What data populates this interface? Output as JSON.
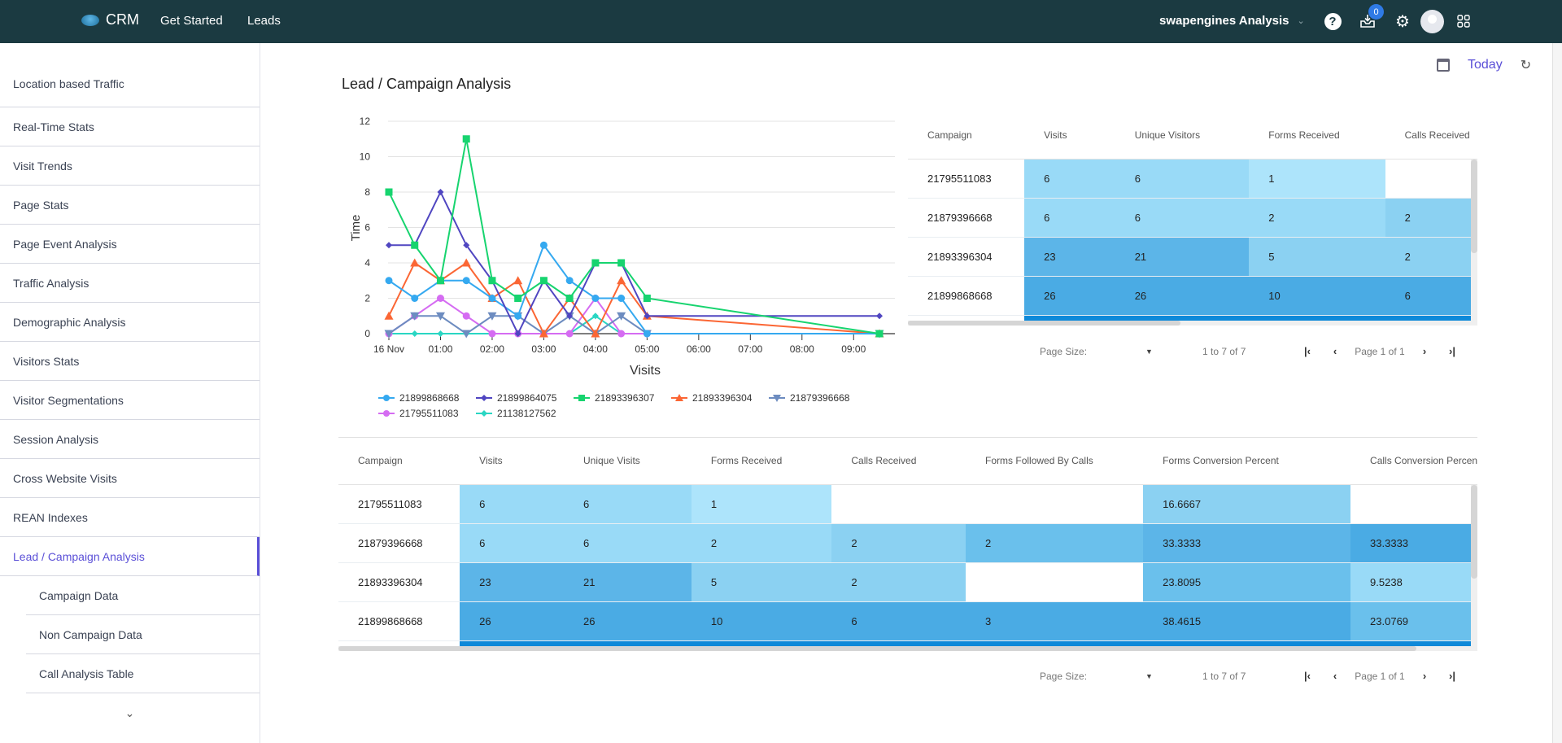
{
  "topbar": {
    "brand": "CRM",
    "nav": [
      "Get Started",
      "Leads"
    ],
    "workspace": "swapengines Analysis",
    "notification_count": "0",
    "icons": [
      "help-icon",
      "inbox-download-icon",
      "gear-icon",
      "avatar",
      "apps-grid-icon"
    ]
  },
  "sidebar": {
    "items": [
      {
        "label": "Location based Traffic"
      },
      {
        "label": "Real-Time Stats"
      },
      {
        "label": "Visit Trends"
      },
      {
        "label": "Page Stats"
      },
      {
        "label": "Page Event Analysis"
      },
      {
        "label": "Traffic Analysis"
      },
      {
        "label": "Demographic Analysis"
      },
      {
        "label": "Visitors Stats"
      },
      {
        "label": "Visitor Segmentations"
      },
      {
        "label": "Session Analysis"
      },
      {
        "label": "Cross Website Visits"
      },
      {
        "label": "REAN Indexes"
      },
      {
        "label": "Lead / Campaign Analysis",
        "active": true
      }
    ],
    "subitems": [
      {
        "label": "Campaign Data"
      },
      {
        "label": "Non Campaign Data"
      },
      {
        "label": "Call Analysis Table"
      }
    ],
    "more_icon": "chevron-down-icon"
  },
  "main": {
    "title": "Lead / Campaign Analysis",
    "date_label": "Today",
    "accent": "#5a4fd7"
  },
  "chart_data": {
    "type": "line",
    "title": "",
    "xlabel": "Visits",
    "ylabel": "Time",
    "ylim": [
      0,
      12
    ],
    "yticks": [
      0,
      2,
      4,
      6,
      8,
      10,
      12
    ],
    "grid": true,
    "legend_position": "bottom",
    "x_tick_labels": [
      "16 Nov",
      "01:00",
      "02:00",
      "03:00",
      "04:00",
      "05:00",
      "06:00",
      "07:00",
      "08:00",
      "09:00"
    ],
    "x_range_hours": [
      0,
      9.5
    ],
    "x_hours": [
      0,
      0.5,
      1,
      1.5,
      2,
      2.5,
      3,
      3.5,
      4,
      4.5,
      5,
      9.5
    ],
    "series": [
      {
        "name": "21899868668",
        "color": "#35a9f0",
        "marker": "circle",
        "values": [
          3,
          2,
          3,
          3,
          2,
          1,
          5,
          3,
          2,
          2,
          0,
          0
        ]
      },
      {
        "name": "21899864075",
        "color": "#5046c1",
        "marker": "diamond",
        "values": [
          5,
          5,
          8,
          5,
          3,
          0,
          3,
          1,
          4,
          4,
          1,
          1
        ]
      },
      {
        "name": "21893396307",
        "color": "#17d46f",
        "marker": "square",
        "values": [
          8,
          5,
          3,
          11,
          3,
          2,
          3,
          2,
          4,
          4,
          2,
          0
        ]
      },
      {
        "name": "21893396304",
        "color": "#fb6634",
        "marker": "triangle",
        "values": [
          1,
          4,
          3,
          4,
          2,
          3,
          0,
          2,
          0,
          3,
          1,
          0
        ]
      },
      {
        "name": "21879396668",
        "color": "#6d8cc0",
        "marker": "triangle-down",
        "values": [
          0,
          1,
          1,
          0,
          1,
          1,
          0,
          1,
          0,
          1,
          0,
          0
        ]
      },
      {
        "name": "21795511083",
        "color": "#d56cf2",
        "marker": "circle",
        "values": [
          0,
          1,
          2,
          1,
          0,
          0,
          0,
          0,
          2,
          0,
          0,
          0
        ]
      },
      {
        "name": "21138127562",
        "color": "#2ad6c3",
        "marker": "diamond",
        "values": [
          0,
          0,
          0,
          0,
          0,
          0,
          0,
          0,
          1,
          0,
          0,
          0
        ]
      }
    ]
  },
  "table_top": {
    "columns": [
      "Campaign",
      "Visits",
      "Unique Visitors",
      "Forms Received",
      "Calls Received"
    ],
    "rows": [
      [
        "21795511083",
        "6",
        "6",
        "1",
        ""
      ],
      [
        "21879396668",
        "6",
        "6",
        "2",
        "2"
      ],
      [
        "21893396304",
        "23",
        "21",
        "5",
        "2"
      ],
      [
        "21899868668",
        "26",
        "26",
        "10",
        "6"
      ]
    ],
    "pager": {
      "page_size_label": "Page Size:",
      "count": "1 to 7 of 7",
      "page_info": "Page 1 of 1"
    }
  },
  "table_bottom": {
    "columns": [
      "Campaign",
      "Visits",
      "Unique Visits",
      "Forms Received",
      "Calls Received",
      "Forms Followed By Calls",
      "Forms Conversion Percent",
      "Calls Conversion Percent"
    ],
    "rows": [
      [
        "21795511083",
        "6",
        "6",
        "1",
        "",
        "",
        "16.6667",
        ""
      ],
      [
        "21879396668",
        "6",
        "6",
        "2",
        "2",
        "2",
        "33.3333",
        "33.3333"
      ],
      [
        "21893396304",
        "23",
        "21",
        "5",
        "2",
        "",
        "23.8095",
        "9.5238"
      ],
      [
        "21899868668",
        "26",
        "26",
        "10",
        "6",
        "3",
        "38.4615",
        "23.0769"
      ]
    ],
    "pager": {
      "page_size_label": "Page Size:",
      "count": "1 to 7 of 7",
      "page_info": "Page 1 of 1"
    }
  },
  "heat_colors": {
    "empty": "#ffffff",
    "l1": "#ade4fb",
    "l2": "#99daf7",
    "l3": "#8bd1f2",
    "l4": "#6ac0ec",
    "l5": "#5cb5e8",
    "l6": "#4aabe4",
    "strip": "#0e89d9"
  }
}
